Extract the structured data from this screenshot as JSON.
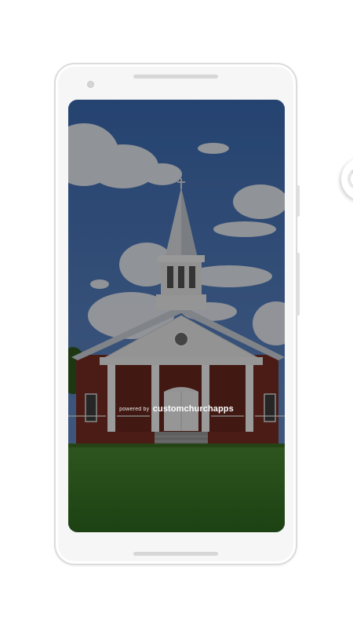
{
  "splash": {
    "powered_by_label": "powered by",
    "brand_name": "customchurchapps",
    "background_subject": "church-building-photo"
  },
  "device": {
    "type": "android-phone-frame"
  },
  "overlay": {
    "indicator": "loading-spinner"
  },
  "colors": {
    "sky": "#3a64a8",
    "grass": "#3f7a2a",
    "brick": "#7a2e22",
    "trim": "#f4f4f4",
    "frame": "#f6f6f6"
  }
}
